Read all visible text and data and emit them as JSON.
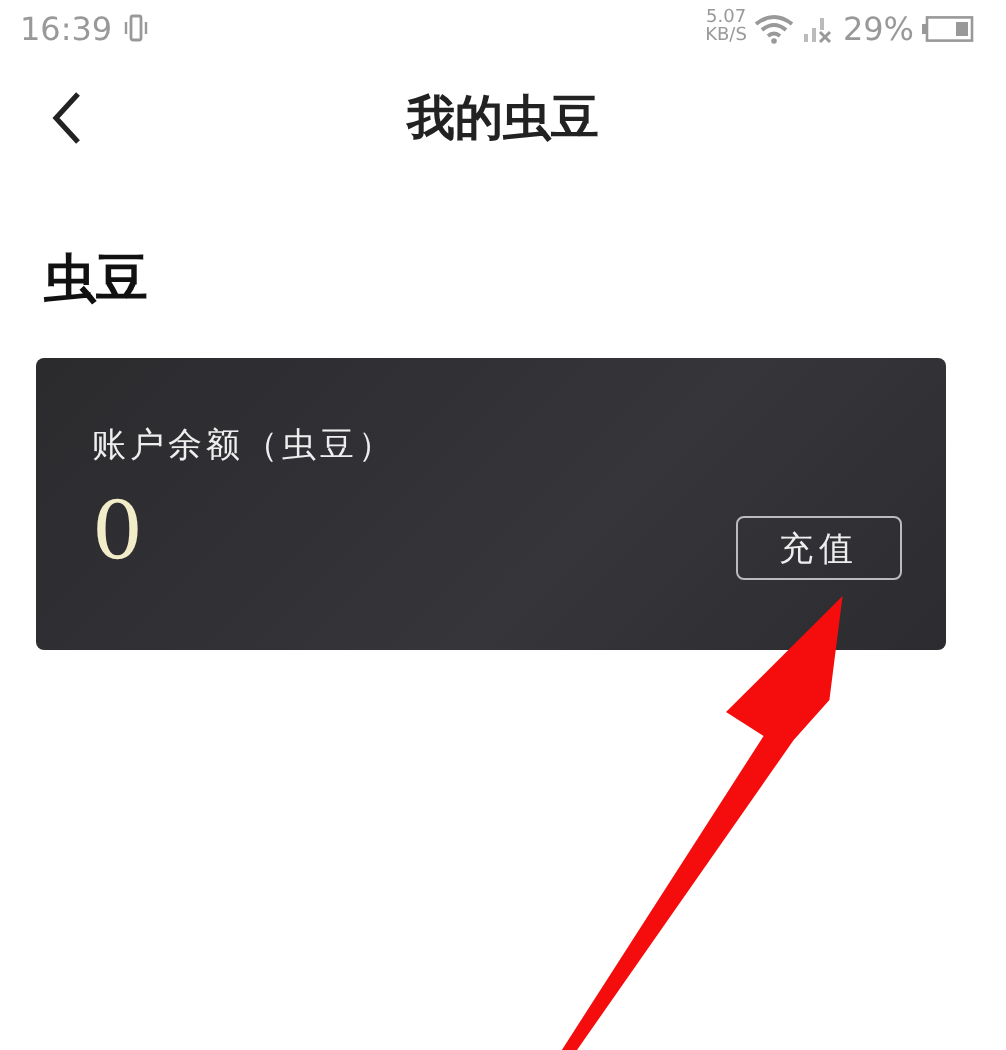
{
  "status_bar": {
    "time": "16:39",
    "net_speed": "5.07",
    "net_unit": "KB/S",
    "battery": "29%"
  },
  "header": {
    "title": "我的虫豆"
  },
  "section": {
    "title": "虫豆"
  },
  "card": {
    "label": "账户余额（虫豆）",
    "balance": "0",
    "button": "充值"
  }
}
